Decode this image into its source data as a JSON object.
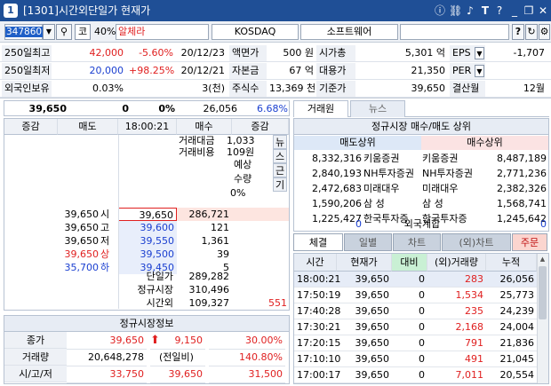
{
  "title": {
    "code_bracket": "[1301]",
    "text": "시간외단일가 현재가",
    "icons": [
      "info-icon",
      "link-icon",
      "speaker-icon",
      "text-size-icon",
      "help-icon",
      "minimize-icon",
      "restore-icon",
      "close-icon"
    ]
  },
  "search": {
    "code": "347860",
    "market_short": "코",
    "margin_rate": "40%",
    "name": "알체라",
    "market": "KOSDAQ",
    "sector": "소프트웨어",
    "help_btn": "?"
  },
  "info": [
    [
      "250일최고",
      "42,000",
      "-5.60%",
      "20/12/23",
      "액면가",
      "500 원",
      "시가총",
      "5,301 억",
      "EPS",
      "-1,707"
    ],
    [
      "250일최저",
      "20,000",
      "+98.25%",
      "20/12/21",
      "자본금",
      "67 억",
      "대용가",
      "21,350",
      "PER",
      ""
    ],
    [
      "외국인보유",
      "0.03%",
      "",
      "3(천)",
      "주식수",
      "13,369 천",
      "기준가",
      "39,650",
      "결산월",
      "12월"
    ]
  ],
  "summary": {
    "price": "39,650",
    "change": "0",
    "rate": "0%",
    "volume": "26,056",
    "ratio": "6.68%"
  },
  "book": {
    "headers": [
      "증감",
      "매도",
      "18:00:21",
      "매수",
      "증감"
    ],
    "amount_label": "거래대금",
    "amount": "1,033",
    "cost_label": "거래비용",
    "cost": "109원",
    "expected_label": "예상",
    "qty_label": "수량",
    "pct": "0%",
    "side_chars": [
      "뉴",
      "스",
      "근",
      "기"
    ],
    "asks": [
      [
        "39,650",
        "시",
        "39,650",
        "286,721"
      ],
      [
        "39,650",
        "고",
        "39,600",
        "121"
      ],
      [
        "39,650",
        "저",
        "39,550",
        "1,361"
      ],
      [
        "39,650",
        "상",
        "39,500",
        "39"
      ],
      [
        "35,700",
        "하",
        "39,450",
        "5"
      ]
    ],
    "footer": [
      [
        "단일가",
        "289,282",
        ""
      ],
      [
        "정규시장",
        "310,496",
        ""
      ],
      [
        "시간외",
        "109,327",
        "551"
      ]
    ]
  },
  "regular": {
    "title": "정규시장정보",
    "rows": [
      [
        "종가",
        "39,650",
        "9,150",
        "30.00%"
      ],
      [
        "거래량",
        "20,648,278",
        "(전일비)",
        "140.80%"
      ],
      [
        "시/고/저",
        "33,750",
        "39,650",
        "31,500"
      ]
    ]
  },
  "right_tabs": [
    "거래원",
    "뉴스"
  ],
  "broker": {
    "title": "정규시장 매수/매도 상위",
    "sell_head": "매도상위",
    "buy_head": "매수상위",
    "rows": [
      [
        "8,332,316",
        "키움증권",
        "키움증권",
        "8,487,189"
      ],
      [
        "2,840,193",
        "NH투자증권",
        "NH투자증권",
        "2,771,236"
      ],
      [
        "2,472,683",
        "미래대우",
        "미래대우",
        "2,382,326"
      ],
      [
        "1,590,206",
        "삼 성",
        "삼 성",
        "1,568,741"
      ],
      [
        "1,225,427",
        "한국투자증",
        "한국투자증",
        "1,245,642"
      ]
    ],
    "foreign_left": "0",
    "foreign_label": "외국계합",
    "foreign_right": "0"
  },
  "bottom_tabs": [
    "체결",
    "일별",
    "차트",
    "(외)차트",
    "주문"
  ],
  "trades": {
    "headers": [
      "시간",
      "현재가",
      "대비",
      "(외)거래량",
      "누적"
    ],
    "rows": [
      [
        "18:00:21",
        "39,650",
        "0",
        "283",
        "26,056"
      ],
      [
        "17:50:19",
        "39,650",
        "0",
        "1,534",
        "25,773"
      ],
      [
        "17:40:28",
        "39,650",
        "0",
        "235",
        "24,239"
      ],
      [
        "17:30:21",
        "39,650",
        "0",
        "2,168",
        "24,004"
      ],
      [
        "17:20:15",
        "39,650",
        "0",
        "791",
        "21,836"
      ],
      [
        "17:10:10",
        "39,650",
        "0",
        "491",
        "21,045"
      ],
      [
        "17:00:17",
        "39,650",
        "0",
        "7,011",
        "20,554"
      ]
    ]
  },
  "colors": {
    "title_bg": "#1f4f96",
    "up": "#e02020",
    "down": "#1a3fd0",
    "highlight": "#fde5e0"
  }
}
